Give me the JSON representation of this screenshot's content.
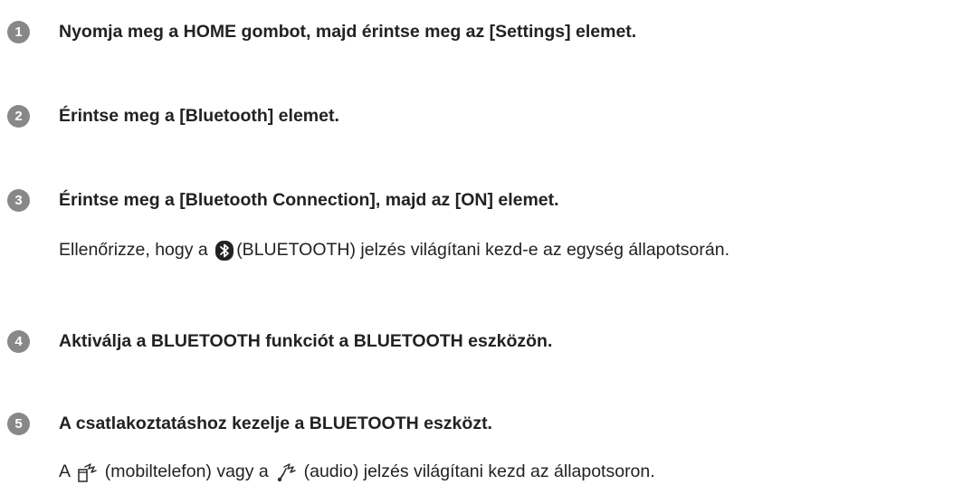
{
  "steps": [
    {
      "number": "1",
      "title": "Nyomja meg a HOME gombot, majd érintse meg az [Settings] elemet."
    },
    {
      "number": "2",
      "title": "Érintse meg a [Bluetooth] elemet."
    },
    {
      "number": "3",
      "title": "Érintse meg a [Bluetooth Connection], majd az [ON] elemet.",
      "note": {
        "before": "Ellenőrizze, hogy a ",
        "icon": "bluetooth-icon",
        "after": "(BLUETOOTH) jelzés világítani kezd-e az egység állapotsorán."
      }
    },
    {
      "number": "4",
      "title": "Aktiválja a BLUETOOTH funkciót a BLUETOOTH eszközön."
    },
    {
      "number": "5",
      "title": "A csatlakoztatáshoz kezelje a BLUETOOTH eszközt.",
      "note": {
        "before": "A ",
        "icon1": "mobile-phone-bluetooth-icon",
        "middle1": " (mobiltelefon) vagy a ",
        "icon2": "audio-bluetooth-icon",
        "after": " (audio) jelzés világítani kezd az állapotsoron."
      }
    }
  ]
}
